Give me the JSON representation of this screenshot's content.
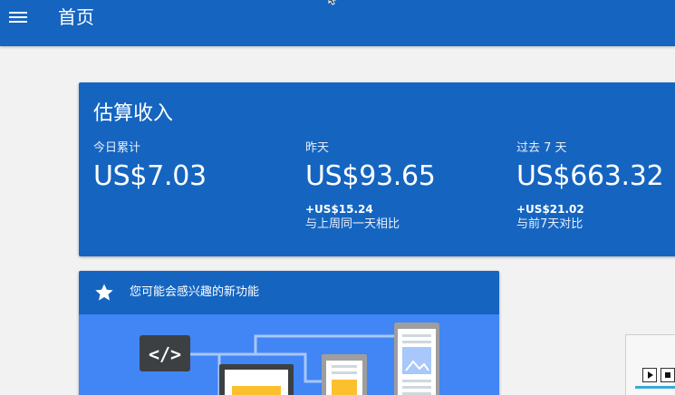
{
  "appbar": {
    "title": "首页",
    "menu_icon": "menu-icon",
    "background": "#1565c0"
  },
  "earnings": {
    "title": "估算收入",
    "background": "#1565c0",
    "stats": [
      {
        "label": "今日累计",
        "value": "US$7.03",
        "delta": "",
        "compare": ""
      },
      {
        "label": "昨天",
        "value": "US$93.65",
        "delta": "+US$15.24",
        "compare": "与上周同一天相比"
      },
      {
        "label": "过去 7 天",
        "value": "US$663.32",
        "delta": "+US$21.02",
        "compare": "与前7天对比"
      }
    ]
  },
  "features": {
    "title": "您可能会感兴趣的新功能",
    "icon": "star-icon",
    "code_badge": "</>",
    "illustration_bg": "#4285f4",
    "accent": "#fbc02d"
  },
  "side_panel": {
    "play_icon": "play-icon",
    "stop_icon": "stop-icon"
  }
}
